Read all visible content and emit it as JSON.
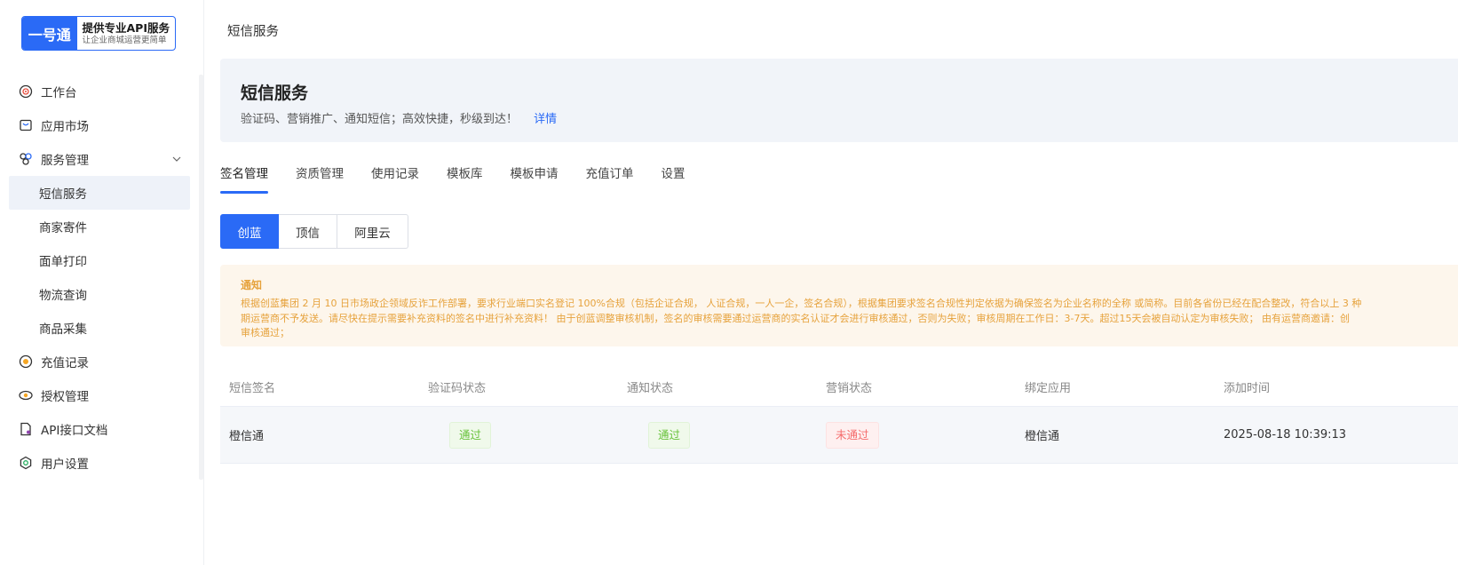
{
  "logo": {
    "mark": "一号通",
    "title": "提供专业API服务",
    "subtitle": "让企业商城运营更简单"
  },
  "sidebar": {
    "items": [
      {
        "label": "工作台",
        "icon": "target-icon"
      },
      {
        "label": "应用市场",
        "icon": "shop-icon"
      },
      {
        "label": "服务管理",
        "icon": "services-icon",
        "expanded": true
      },
      {
        "label": "短信服务",
        "sub": true,
        "active": true
      },
      {
        "label": "商家寄件",
        "sub": true
      },
      {
        "label": "面单打印",
        "sub": true
      },
      {
        "label": "物流查询",
        "sub": true
      },
      {
        "label": "商品采集",
        "sub": true
      },
      {
        "label": "充值记录",
        "icon": "recharge-icon"
      },
      {
        "label": "授权管理",
        "icon": "key-icon"
      },
      {
        "label": "API接口文档",
        "icon": "doc-icon"
      },
      {
        "label": "用户设置",
        "icon": "settings-icon"
      }
    ]
  },
  "breadcrumb": "短信服务",
  "banner": {
    "title": "短信服务",
    "description": "验证码、营销推广、通知短信；高效快捷，秒级到达！",
    "link": "详情"
  },
  "tabs": [
    {
      "label": "签名管理",
      "active": true
    },
    {
      "label": "资质管理"
    },
    {
      "label": "使用记录"
    },
    {
      "label": "模板库"
    },
    {
      "label": "模板申请"
    },
    {
      "label": "充值订单"
    },
    {
      "label": "设置"
    }
  ],
  "providers": [
    {
      "label": "创蓝",
      "active": true
    },
    {
      "label": "顶信"
    },
    {
      "label": "阿里云"
    }
  ],
  "notice": {
    "title": "通知",
    "lines": [
      "根据创蓝集团 2 月 10 日市场政企领域反诈工作部署，要求行业端口实名登记 100%合规（包括企证合规， 人证合规，一人一企，签名合规），根据集团要求签名合规性判定依据为确保签名为企业名称的全称 或简称。目前各省份已经在配合整改，符合以上 3 种",
      "期运营商不予发送。请尽快在提示需要补充资料的签名中进行补充资料！ 由于创蓝调整审核机制，签名的审核需要通过运营商的实名认证才会进行审核通过，否则为失败；审核周期在工作日：3-7天。超过15天会被自动认定为审核失败； 由有运营商邀请：创",
      "审核通过；"
    ]
  },
  "table": {
    "headers": [
      "短信签名",
      "验证码状态",
      "通知状态",
      "营销状态",
      "绑定应用",
      "添加时间"
    ],
    "rows": [
      {
        "signature": "橙信通",
        "captcha_status": "通过",
        "notify_status": "通过",
        "marketing_status": "未通过",
        "app": "橙信通",
        "time": "2025-08-18 10:39:13"
      }
    ]
  },
  "colors": {
    "primary": "#2a6af6",
    "success": "#67c23a",
    "danger": "#f56c6c",
    "warning": "#e6a23c"
  }
}
